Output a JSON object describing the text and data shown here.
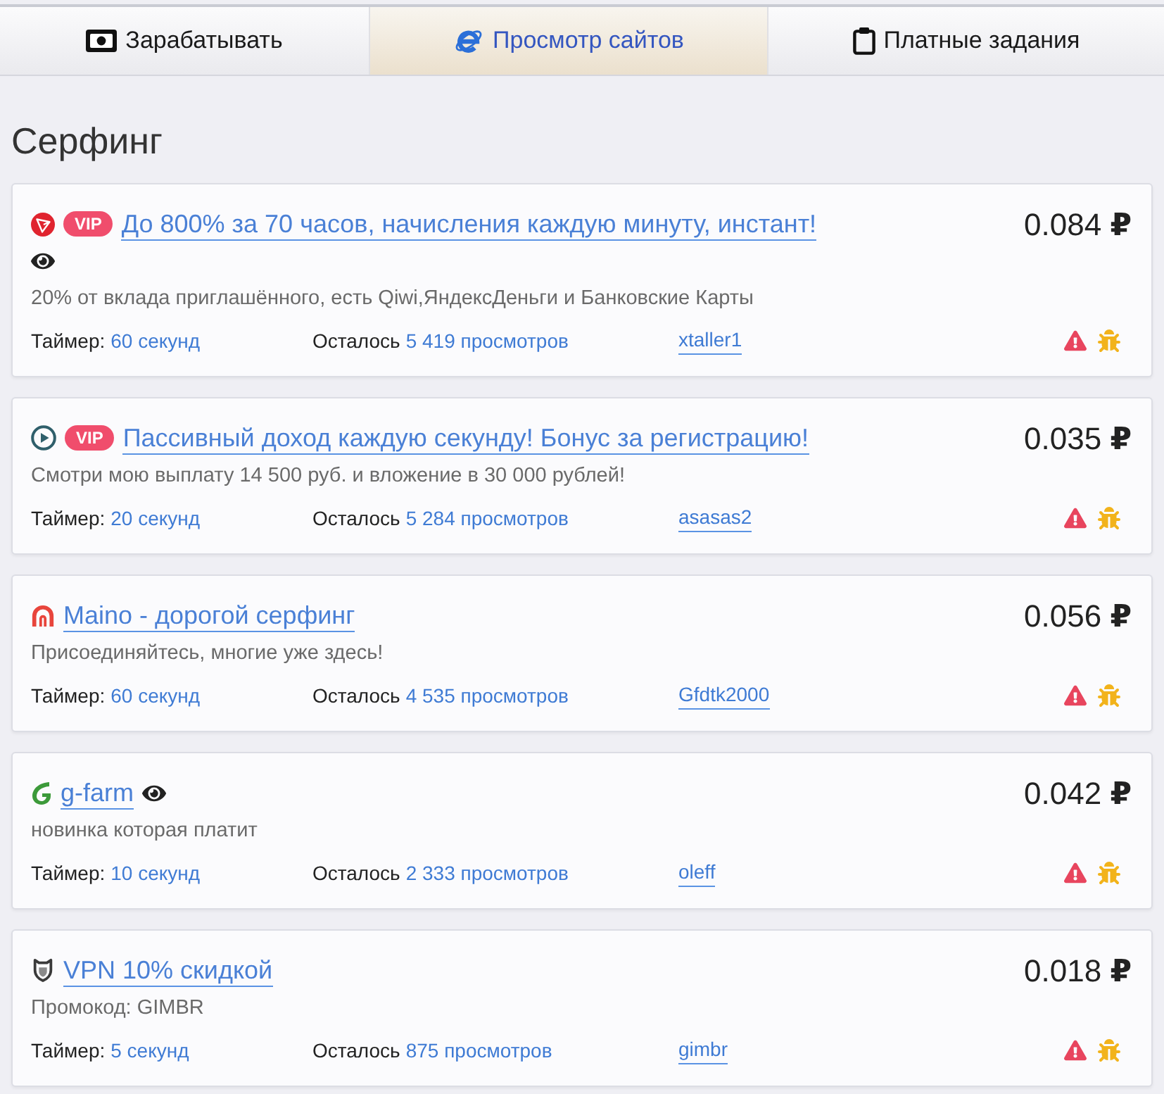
{
  "tabs": [
    {
      "label": "Зарабатывать",
      "selected": false
    },
    {
      "label": "Просмотр сайтов",
      "selected": true
    },
    {
      "label": "Платные задания",
      "selected": false
    }
  ],
  "heading": "Серфинг",
  "cards": [
    {
      "badge": "VIP",
      "title": "До 800% за 70 часов, начисления каждую минуту, инстант!",
      "viewed": true,
      "description": "20% от вклада приглашённого, есть Qiwi,ЯндексДеньги и Банковские Карты",
      "price": "0.084 **₽**",
      "timer_label": "Таймер:",
      "timer": "60 секунд",
      "remaining_label": "Осталось",
      "remaining": "5 419 просмотров",
      "author": "xtaller1"
    },
    {
      "badge": "VIP",
      "title": "Пассивный доход каждую секунду! Бонус за регистрацию!",
      "viewed": false,
      "description": "Смотри мою выплату 14 500 руб. и вложение в 30 000 рублей!",
      "price": "0.035 **₽**",
      "timer_label": "Таймер:",
      "timer": "20 секунд",
      "remaining_label": "Осталось",
      "remaining": "5 284 просмотров",
      "author": "asasas2"
    },
    {
      "title": "Maino - дорогой серфинг",
      "viewed": false,
      "description": "Присоединяйтесь, многие уже здесь!",
      "price": "0.056 **₽**",
      "timer_label": "Таймер:",
      "timer": "60 секунд",
      "remaining_label": "Осталось",
      "remaining": "4 535 просмотров",
      "author": "Gfdtk2000"
    },
    {
      "title": "g-farm",
      "viewed": true,
      "description": "новинка которая платит",
      "price": "0.042 **₽**",
      "timer_label": "Таймер:",
      "timer": "10 секунд",
      "remaining_label": "Осталось",
      "remaining": "2 333 просмотров",
      "author": "oleff"
    },
    {
      "title": "VPN 10% скидкой",
      "viewed": false,
      "description": "Промокод: GIMBR",
      "price": "0.018 **₽**",
      "timer_label": "Таймер:",
      "timer": "5 секунд",
      "remaining_label": "Осталось",
      "remaining": "875 просмотров",
      "author": "gimbr"
    }
  ]
}
